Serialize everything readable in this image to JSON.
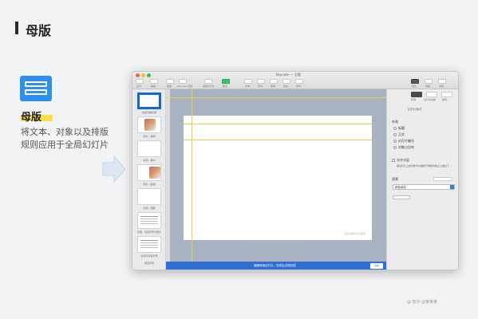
{
  "header": {
    "title": "母版"
  },
  "feature": {
    "title": "母版",
    "desc_line1": "将文本、对象以及排版",
    "desc_line2": "规则应用于全局幻灯片"
  },
  "window": {
    "title": "Keynote — 主题",
    "toolbar": [
      {
        "label": "显示"
      },
      {
        "label": "缩放"
      },
      {
        "label": "播放"
      },
      {
        "label": "Keynote 直播"
      },
      {
        "label": "添加幻灯片"
      },
      {
        "label": "图表"
      },
      {
        "label": "文本"
      },
      {
        "label": "形状"
      },
      {
        "label": "媒体"
      },
      {
        "label": "批注"
      },
      {
        "label": "协作"
      },
      {
        "label": "格式"
      },
      {
        "label": "动画"
      },
      {
        "label": "文稿"
      }
    ],
    "slides": [
      {
        "label": "标题与副标题"
      },
      {
        "label": "照片－横排"
      },
      {
        "label": "标题－居中"
      },
      {
        "label": "照片－竖排"
      },
      {
        "label": "标题－顶部"
      },
      {
        "label": "标题、项目符号与照片"
      },
      {
        "label": "标题与项目符号"
      },
      {
        "label": "项目符号"
      }
    ],
    "slide_number": "演示文稿幻灯片编号",
    "bottom_bar": {
      "text": "编辑母版幻灯片，完成后点按完成",
      "button": "完成"
    },
    "inspector": {
      "tabs": [
        {
          "label": "外观"
        },
        {
          "label": "幻灯片切换"
        },
        {
          "label": "排列"
        }
      ],
      "subtitle": "幻灯片版式",
      "section_label": "外观",
      "options": [
        {
          "label": "标题"
        },
        {
          "label": "正文"
        },
        {
          "label": "幻灯片编号"
        },
        {
          "label": "对象占位符"
        }
      ],
      "checkbox_label": "允许分层",
      "note": "使幻灯片上的对象可以被置于母版对象之上或之下",
      "background_label": "背景",
      "select_value": "颜色填充"
    }
  },
  "watermark": "@ 知乎 @某某某"
}
